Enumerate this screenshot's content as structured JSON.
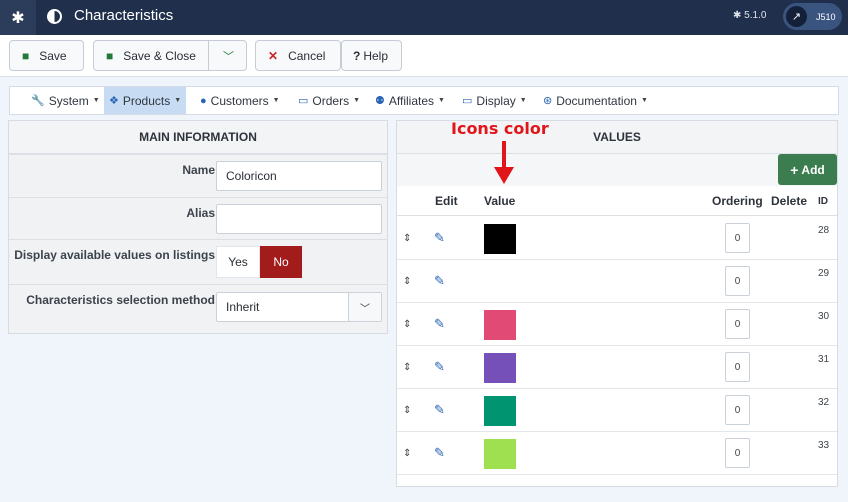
{
  "header": {
    "title": "Characteristics",
    "version": "5.1.0",
    "site_label": "J510"
  },
  "toolbar": {
    "save_label": "Save",
    "save_close_label": "Save & Close",
    "cancel_label": "Cancel",
    "help_label": "Help"
  },
  "menu": {
    "items": [
      {
        "label": "System",
        "icon": "wrench-icon"
      },
      {
        "label": "Products",
        "icon": "cubes-icon"
      },
      {
        "label": "Customers",
        "icon": "user-icon"
      },
      {
        "label": "Orders",
        "icon": "credit-card-icon"
      },
      {
        "label": "Affiliates",
        "icon": "users-icon"
      },
      {
        "label": "Display",
        "icon": "monitor-icon"
      },
      {
        "label": "Documentation",
        "icon": "lifebuoy-icon"
      }
    ]
  },
  "main_info": {
    "heading": "MAIN INFORMATION",
    "name_label": "Name",
    "name_value": "Coloricon",
    "alias_label": "Alias",
    "alias_value": "",
    "display_label": "Display available values on listings",
    "yes_label": "Yes",
    "no_label": "No",
    "method_label": "Characteristics selection method",
    "method_value": "Inherit"
  },
  "values_panel": {
    "heading": "VALUES",
    "add_label": "Add",
    "columns": {
      "edit": "Edit",
      "value": "Value",
      "ordering": "Ordering",
      "delete": "Delete",
      "id": "ID"
    },
    "rows": [
      {
        "color": "#000000",
        "ordering": "0",
        "id": "28"
      },
      {
        "color": "",
        "ordering": "0",
        "id": "29"
      },
      {
        "color": "#e04a74",
        "ordering": "0",
        "id": "30"
      },
      {
        "color": "#7550b8",
        "ordering": "0",
        "id": "31"
      },
      {
        "color": "#009470",
        "ordering": "0",
        "id": "32"
      },
      {
        "color": "#9ee050",
        "ordering": "0",
        "id": "33"
      }
    ]
  },
  "annotation": {
    "text": "Icons color",
    "color": "#e0161b"
  },
  "colors": {
    "header_bg": "#1f2f4c",
    "no_active": "#a21c1c",
    "add_button": "#3b7d4e",
    "accent": "#2a65b4"
  }
}
